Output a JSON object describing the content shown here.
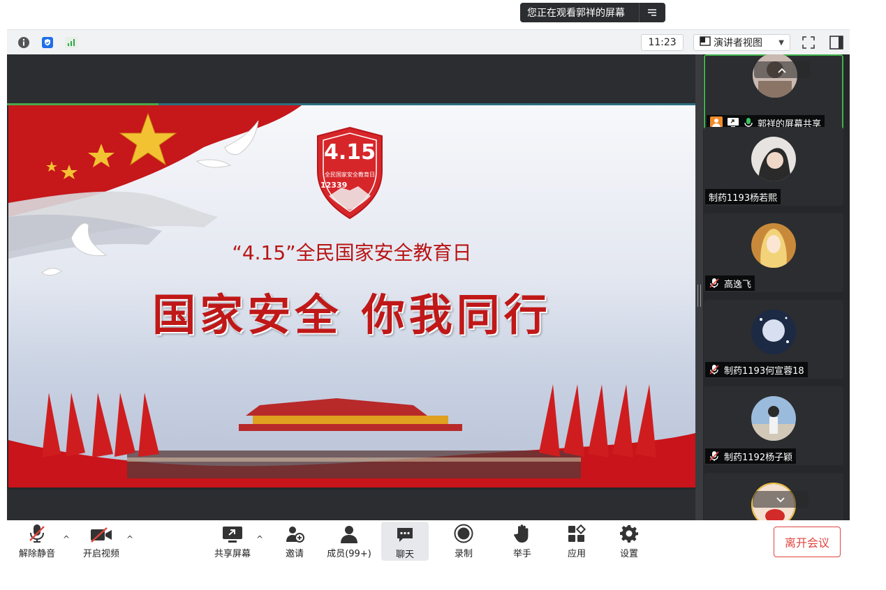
{
  "banner": {
    "viewing_text": "您正在观看郭祥的屏幕"
  },
  "toolbar": {
    "time": "11:23",
    "view_mode": "演讲者视图"
  },
  "slide": {
    "badge_number": "4.15",
    "badge_subtitle": "全民国家安全教育日",
    "badge_code": "12339",
    "subtitle": "“4.15”全民国家安全教育日",
    "slogan": "国家安全 你我同行"
  },
  "participants": [
    {
      "name": "郭祥的屏幕共享",
      "muted": false,
      "active": true,
      "avatar_color": "#b9a9a0"
    },
    {
      "name": "制药1193杨若熙",
      "muted": false,
      "active": false,
      "avatar_color": "#d8d4d0"
    },
    {
      "name": "高逸飞",
      "muted": true,
      "active": false,
      "avatar_color": "#e0b070"
    },
    {
      "name": "制药1193何宣蓉18",
      "muted": true,
      "active": false,
      "avatar_color": "#1c2a44"
    },
    {
      "name": "制药1192杨子颖",
      "muted": true,
      "active": false,
      "avatar_color": "#7fa6cf"
    }
  ],
  "controls": {
    "unmute": "解除静音",
    "start_video": "开启视频",
    "share_screen": "共享屏幕",
    "invite": "邀请",
    "members": "成员(99+)",
    "chat": "聊天",
    "record": "录制",
    "raise_hand": "举手",
    "apps": "应用",
    "settings": "设置",
    "leave": "离开会议"
  },
  "colors": {
    "accent_green": "#3fb24a",
    "leave_red": "#e0443f",
    "slide_red": "#c01818",
    "dark_bg": "#2b2d30"
  }
}
